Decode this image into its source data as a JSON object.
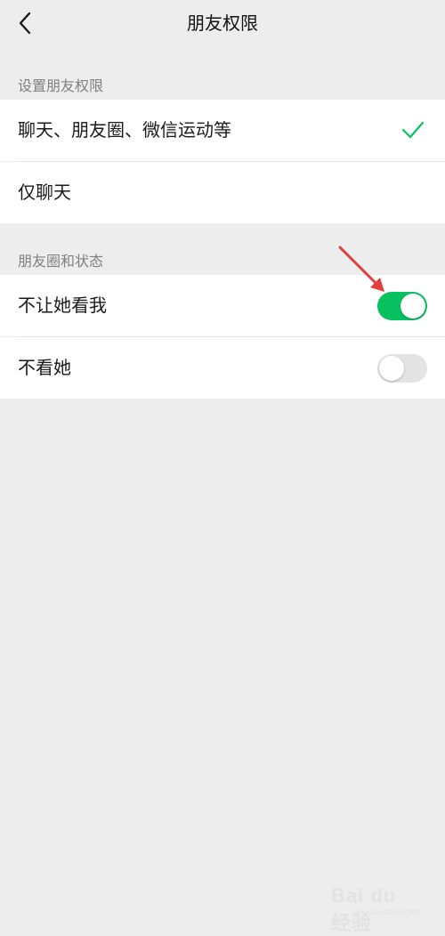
{
  "nav": {
    "title": "朋友权限",
    "back_icon": "chevron-left-icon"
  },
  "sections": [
    {
      "header": "设置朋友权限",
      "items": [
        {
          "label": "聊天、朋友圈、微信运动等",
          "selected": true
        },
        {
          "label": "仅聊天",
          "selected": false
        }
      ]
    },
    {
      "header": "朋友圈和状态",
      "items": [
        {
          "label": "不让她看我",
          "toggle_on": true
        },
        {
          "label": "不看她",
          "toggle_on": false
        }
      ]
    }
  ],
  "colors": {
    "background": "#ededed",
    "accent_green": "#07c160",
    "toggle_off": "#e3e3e3",
    "annotation_arrow": "#e0403a"
  },
  "watermark": {
    "brand": "Bai du 经验",
    "url": "jingyan.baidu.com"
  }
}
